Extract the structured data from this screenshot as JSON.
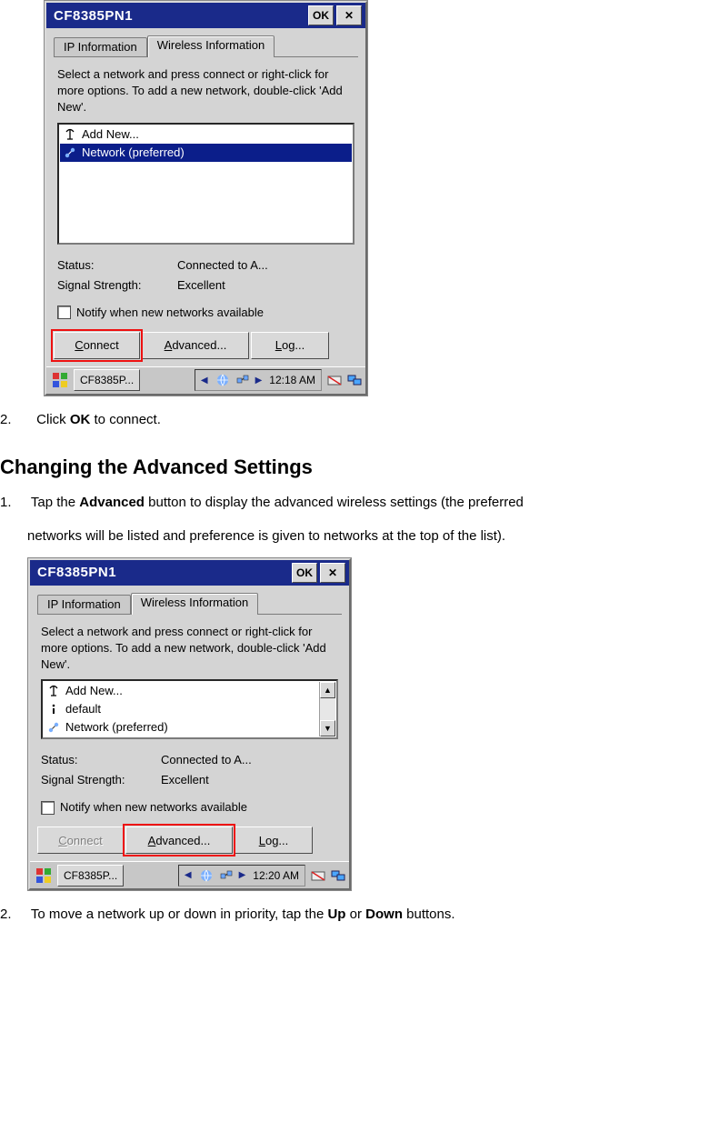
{
  "screenshot1": {
    "titlebar": {
      "title": "CF8385PN1",
      "ok": "OK"
    },
    "tabs": {
      "ip": "IP Information",
      "wifi": "Wireless Information"
    },
    "help_text": "Select a network and press connect or right-click for more options.  To add a new network, double-click 'Add New'.",
    "list": {
      "add_new": "Add New...",
      "items": [
        {
          "label": "Network (preferred)",
          "selected": true
        }
      ]
    },
    "status": {
      "status_label": "Status:",
      "status_value": "Connected to A...",
      "signal_label": "Signal Strength:",
      "signal_value": "Excellent"
    },
    "notify_label": "Notify when new networks available",
    "buttons": {
      "connect": "Connect",
      "advanced": "Advanced...",
      "log": "Log...",
      "connect_u": "C",
      "advanced_u": "A",
      "log_u": "L",
      "connect_rest": "onnect",
      "advanced_rest": "dvanced...",
      "log_rest": "og..."
    },
    "taskbar": {
      "task_label": "CF8385P...",
      "clock": "12:18 AM"
    }
  },
  "doc": {
    "step2a_num": "2.",
    "step2a_pre": "Click ",
    "step2a_bold": "OK",
    "step2a_post": " to connect.",
    "heading": "Changing the Advanced Settings",
    "step1_num": "1.",
    "step1_pre": "Tap the ",
    "step1_bold": "Advanced",
    "step1_post": " button to display the advanced wireless settings (the preferred",
    "step1_line2": "networks will be listed and preference is given to networks at the top of the list).",
    "step2b_num": "2.",
    "step2b_pre": "To move a network up or down in priority, tap the ",
    "step2b_bold1": "Up",
    "step2b_mid": " or ",
    "step2b_bold2": "Down",
    "step2b_post": " buttons."
  },
  "screenshot2": {
    "titlebar": {
      "title": "CF8385PN1",
      "ok": "OK"
    },
    "tabs": {
      "ip": "IP Information",
      "wifi": "Wireless Information"
    },
    "help_text": "Select a network and press connect or right-click for more options.  To add a new network, double-click 'Add New'.",
    "list": {
      "add_new": "Add New...",
      "items": [
        {
          "label": "default",
          "selected": false
        },
        {
          "label": "Network (preferred)",
          "selected": false
        }
      ]
    },
    "status": {
      "status_label": "Status:",
      "status_value": "Connected to A...",
      "signal_label": "Signal Strength:",
      "signal_value": "Excellent"
    },
    "notify_label": "Notify when new networks available",
    "buttons": {
      "connect": "Connect",
      "advanced": "Advanced...",
      "log": "Log...",
      "connect_u": "C",
      "advanced_u": "A",
      "log_u": "L",
      "connect_rest": "onnect",
      "advanced_rest": "dvanced...",
      "log_rest": "og..."
    },
    "taskbar": {
      "task_label": "CF8385P...",
      "clock": "12:20 AM"
    }
  }
}
